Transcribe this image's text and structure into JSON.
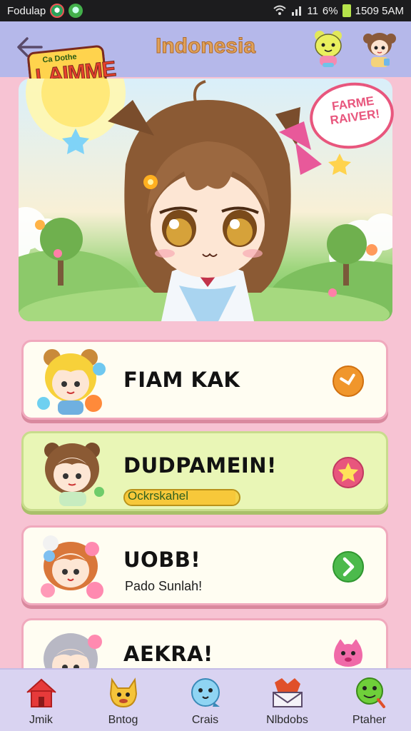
{
  "status_bar": {
    "app_name": "Fodulap",
    "signal": "11",
    "battery": "6%",
    "time": "1509 5AM"
  },
  "header": {
    "title": "Indonesia",
    "logo_small": "Ca Dothe",
    "logo_big": "LAIMME",
    "back_icon": "back-arrow-icon"
  },
  "hero": {
    "speech_bubble": "FARME RAIVER!"
  },
  "list": [
    {
      "name": "FIAM KAK",
      "sub": "",
      "action_icon": "chevron-right-icon",
      "action_color": "#f0962c",
      "style": "light"
    },
    {
      "name": "DUDPAMEIN!",
      "sub": "Ockrskahel",
      "progress": 0.97,
      "action_icon": "star-icon",
      "action_color": "#e8567d",
      "style": "green"
    },
    {
      "name": "UOBB!",
      "sub": "Pado Sunlah!",
      "action_icon": "chevron-right-icon",
      "action_color": "#4cba4c",
      "style": "light"
    },
    {
      "name": "AEKRA!",
      "sub": "",
      "action_icon": "cat-icon",
      "action_color": "#f06aa8",
      "style": "light"
    }
  ],
  "bottom_nav": [
    {
      "label": "Jmik",
      "icon": "home-icon"
    },
    {
      "label": "Bntog",
      "icon": "fox-icon"
    },
    {
      "label": "Crais",
      "icon": "bird-icon"
    },
    {
      "label": "Nlbdobs",
      "icon": "envelope-icon"
    },
    {
      "label": "Ptaher",
      "icon": "frog-icon"
    }
  ],
  "colors": {
    "header_bg": "#b5b8ea",
    "page_bg": "#f7c3d3",
    "nav_bg": "#d9d3f1",
    "accent_pink": "#e8567d"
  }
}
